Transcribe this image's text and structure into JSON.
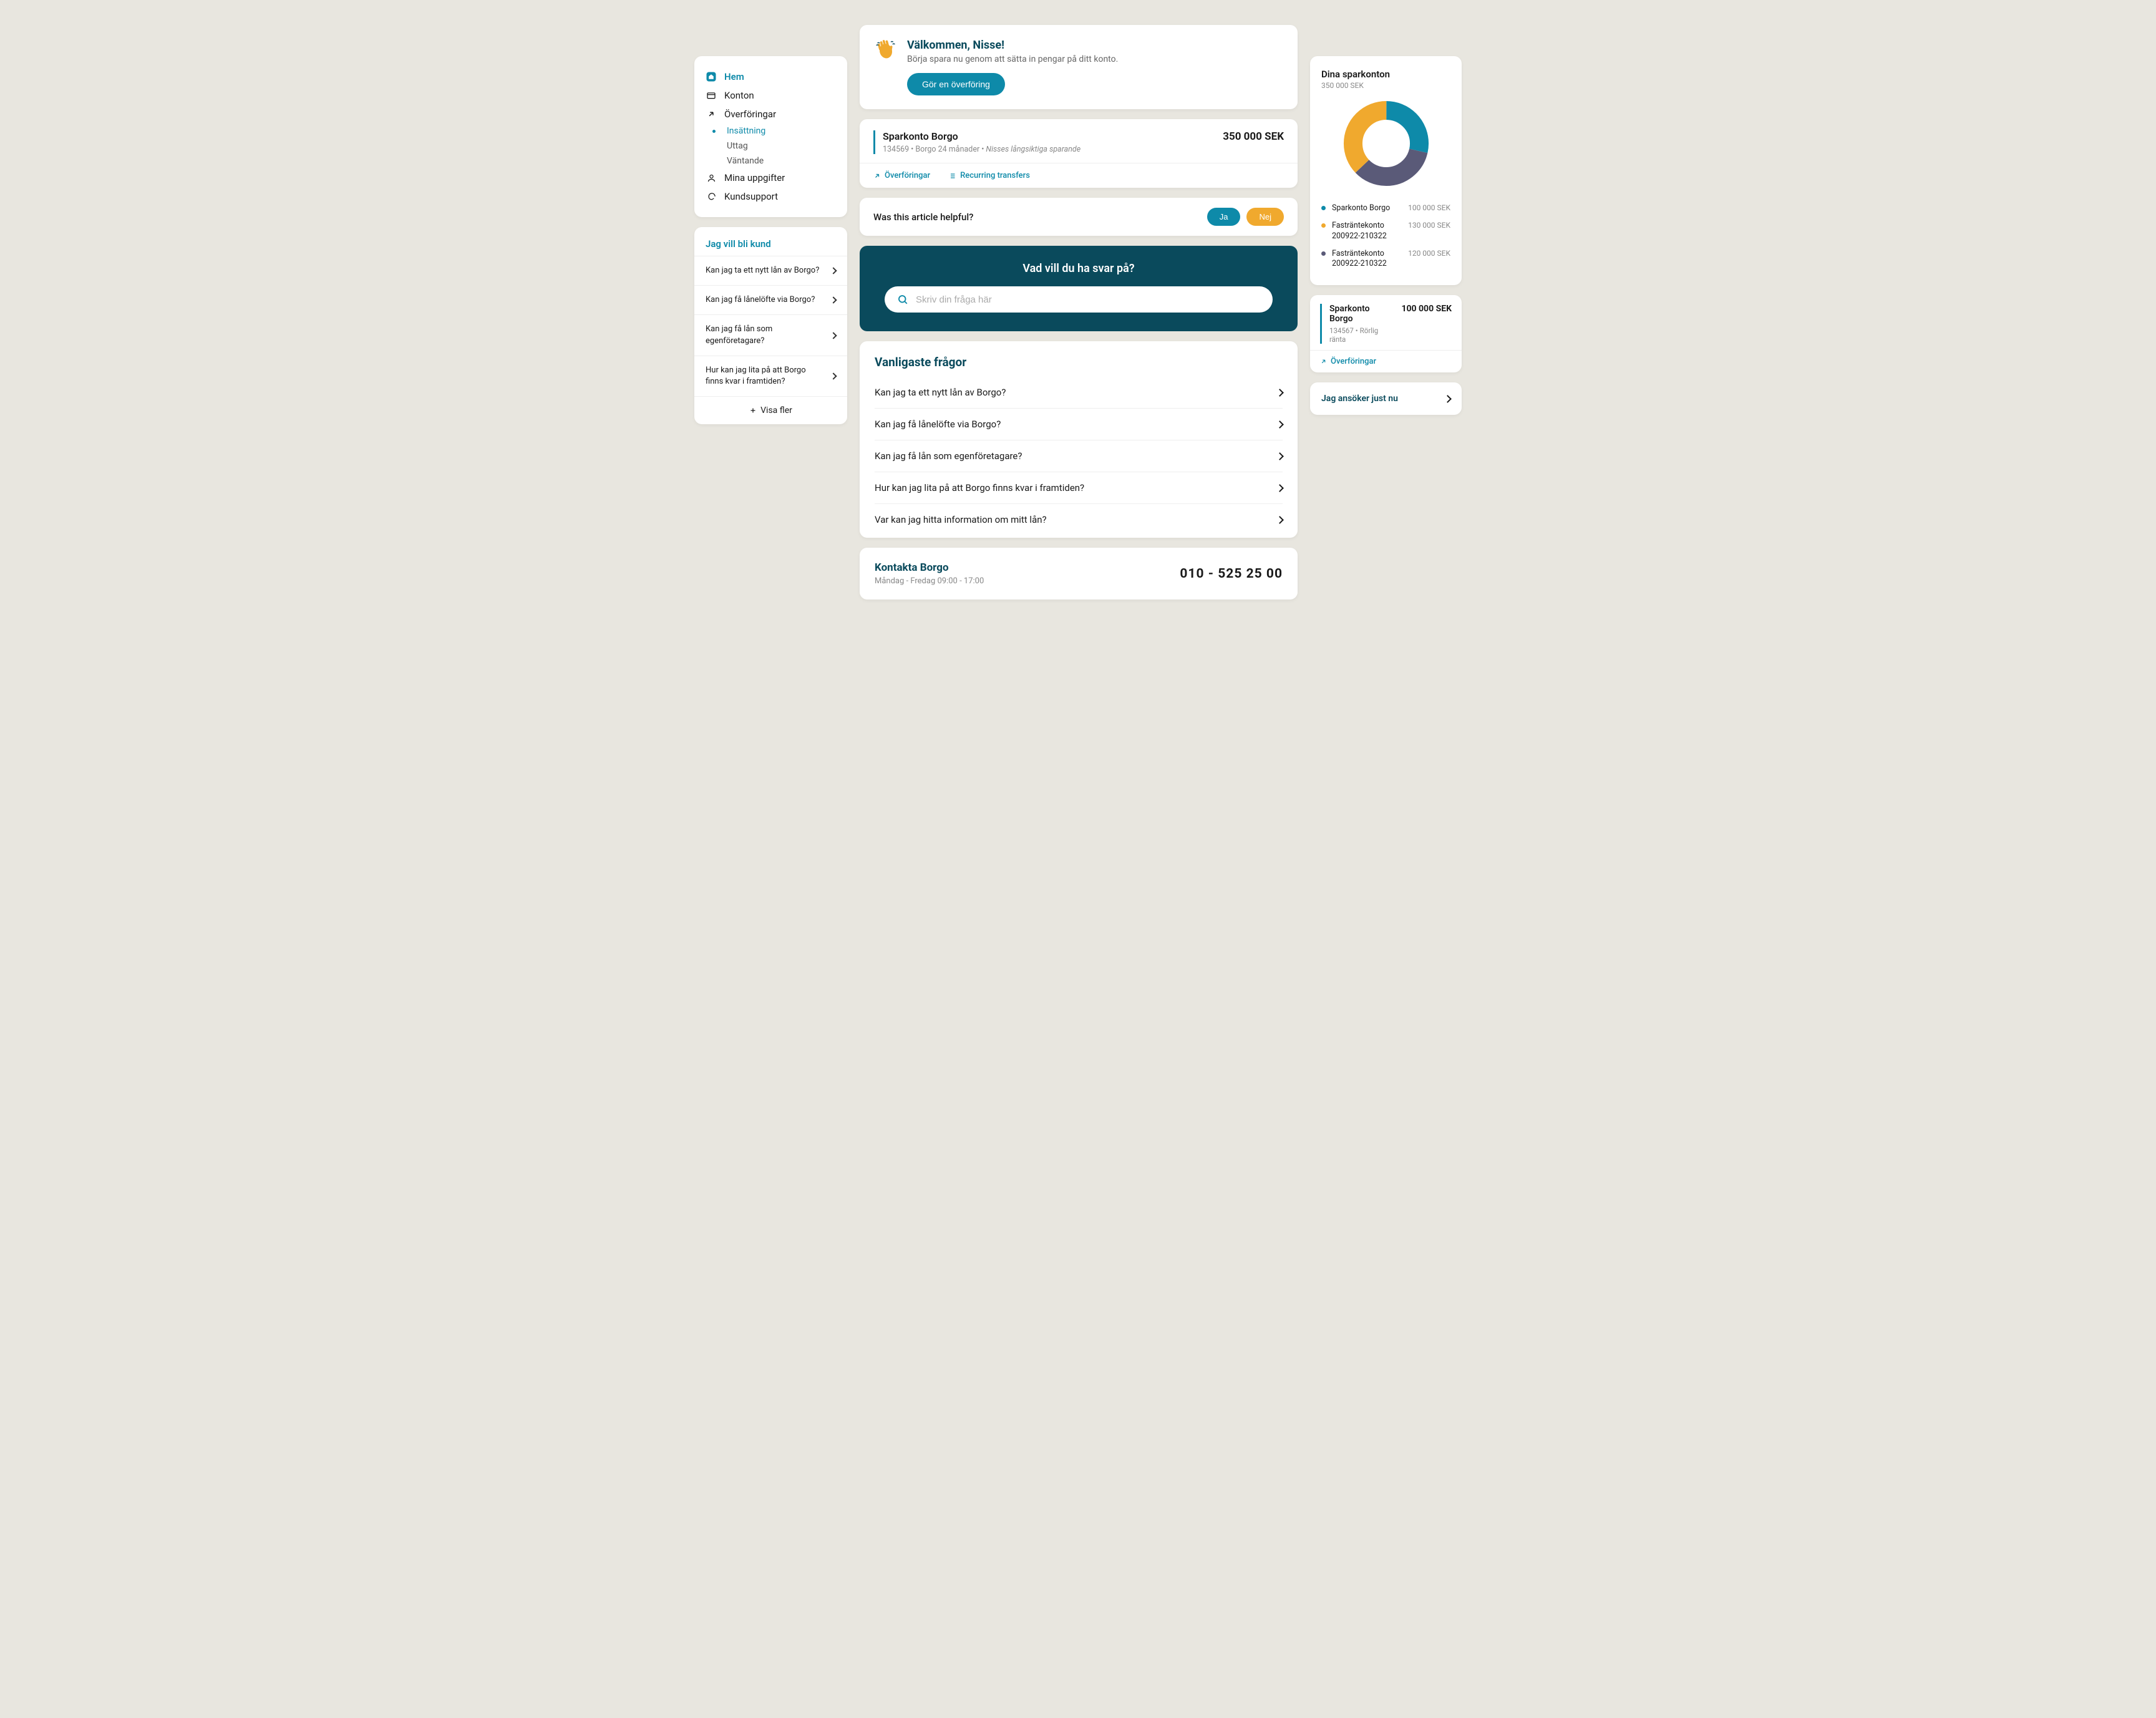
{
  "nav": {
    "items": [
      {
        "label": "Hem"
      },
      {
        "label": "Konton"
      },
      {
        "label": "Överföringar"
      },
      {
        "label": "Mina uppgifter"
      },
      {
        "label": "Kundsupport"
      }
    ],
    "sub": [
      {
        "label": "Insättning"
      },
      {
        "label": "Uttag"
      },
      {
        "label": "Väntande"
      }
    ]
  },
  "faq_side": {
    "heading": "Jag vill bli kund",
    "items": [
      "Kan jag ta ett nytt lån av Borgo?",
      "Kan jag få lånelöfte via Borgo?",
      "Kan jag få lån som egenföretagare?",
      "Hur kan jag lita på att Borgo finns kvar i framtiden?"
    ],
    "show_more": "Visa fler"
  },
  "welcome": {
    "title": "Välkommen, Nisse!",
    "body": "Börja spara nu genom att sätta in pengar på ditt konto.",
    "cta": "Gör en överföring"
  },
  "account_main": {
    "name": "Sparkonto Borgo",
    "amount": "350 000 SEK",
    "number": "134569",
    "product": "Borgo 24 månader",
    "nick": "Nisses långsiktiga sparande",
    "action1": "Överföringar",
    "action2": "Recurring transfers"
  },
  "helpful": {
    "question": "Was this article helpful?",
    "yes": "Ja",
    "no": "Nej"
  },
  "search": {
    "heading": "Vad vill du ha svar på?",
    "placeholder": "Skriv din fråga här"
  },
  "faq_main": {
    "heading": "Vanligaste frågor",
    "items": [
      "Kan jag ta ett nytt lån av Borgo?",
      "Kan jag få lånelöfte via Borgo?",
      "Kan jag få lån som egenföretagare?",
      "Hur kan jag lita på att Borgo finns kvar i framtiden?",
      "Var kan jag hitta information om mitt lån?"
    ]
  },
  "contact": {
    "heading": "Kontakta Borgo",
    "hours": "Måndag - Fredag 09:00 - 17:00",
    "phone": "010 - 525 25 00"
  },
  "donut": {
    "heading": "Dina sparkonton",
    "total": "350 000 SEK",
    "legend": [
      {
        "name": "Sparkonto Borgo",
        "value": "100 000 SEK",
        "color": "#0E8AA9"
      },
      {
        "name": "Fasträntekonto 200922-210322",
        "value": "130 000 SEK",
        "color": "#f0a92e"
      },
      {
        "name": "Fasträntekonto 200922-210322",
        "value": "120 000 SEK",
        "color": "#5a5a78"
      }
    ]
  },
  "chart_data": {
    "type": "pie",
    "title": "Dina sparkonton",
    "total_label": "350 000 SEK",
    "categories": [
      "Sparkonto Borgo",
      "Fasträntekonto 200922-210322",
      "Fasträntekonto 200922-210322"
    ],
    "values": [
      100000,
      130000,
      120000
    ],
    "colors": [
      "#0E8AA9",
      "#f0a92e",
      "#5a5a78"
    ]
  },
  "account_small": {
    "name": "Sparkonto Borgo",
    "amount": "100 000 SEK",
    "number": "134567",
    "product": "Rörlig ränta",
    "action": "Överföringar"
  },
  "apply": {
    "label": "Jag ansöker just nu"
  }
}
